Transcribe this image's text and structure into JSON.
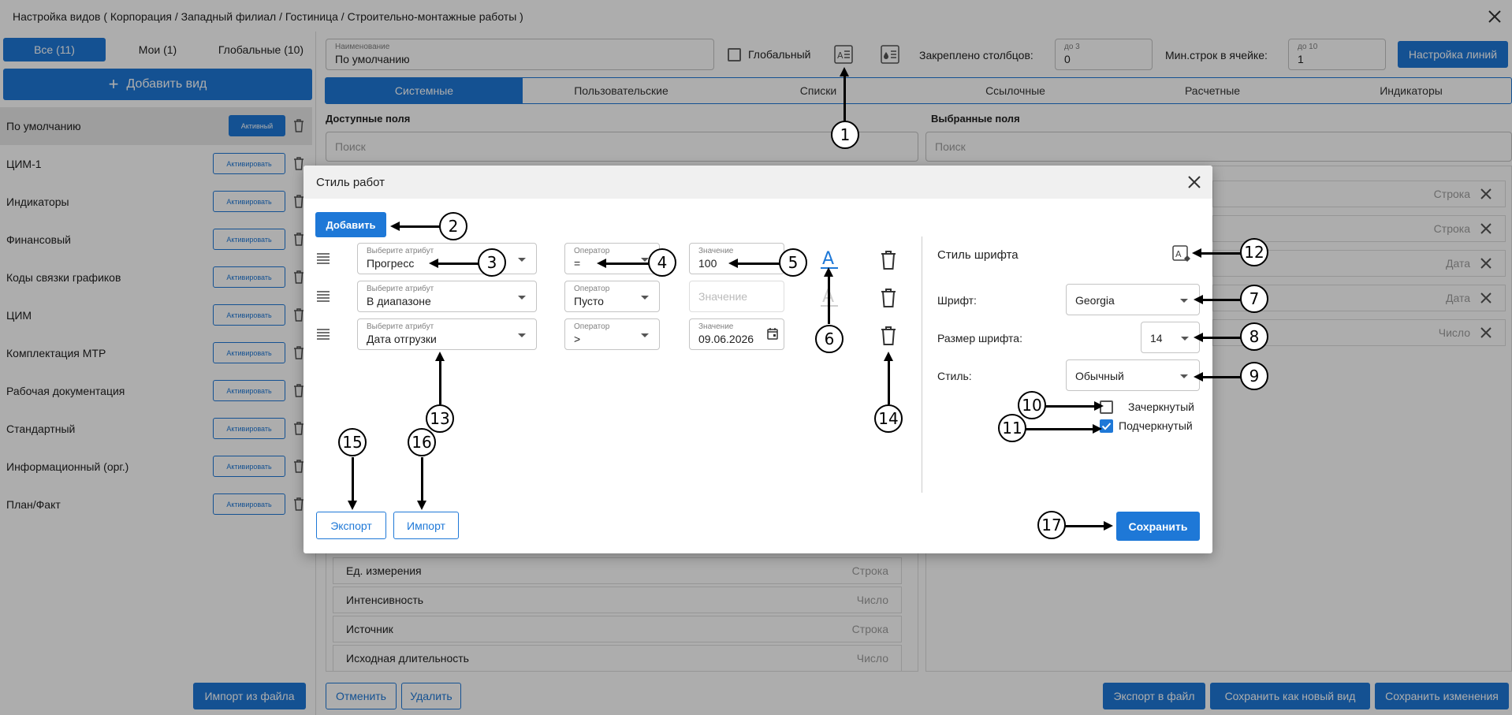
{
  "window": {
    "title": "Настройка видов ( Корпорация / Западный филиал / Гостиница / Строительно-монтажные работы )"
  },
  "left": {
    "filters": [
      "Все (11)",
      "Мои (1)",
      "Глобальные (10)"
    ],
    "add_view": "Добавить вид",
    "views": [
      {
        "name": "По умолчанию",
        "btn": "Активный"
      },
      {
        "name": "ЦИМ-1",
        "btn": "Активировать"
      },
      {
        "name": "Индикаторы",
        "btn": "Активировать"
      },
      {
        "name": "Финансовый",
        "btn": "Активировать"
      },
      {
        "name": "Коды связки графиков",
        "btn": "Активировать"
      },
      {
        "name": "ЦИМ",
        "btn": "Активировать"
      },
      {
        "name": "Комплектация МТР",
        "btn": "Активировать"
      },
      {
        "name": "Рабочая документация",
        "btn": "Активировать"
      },
      {
        "name": "Стандартный",
        "btn": "Активировать"
      },
      {
        "name": "Информационный (орг.)",
        "btn": "Активировать"
      },
      {
        "name": "План/Факт",
        "btn": "Активировать"
      }
    ],
    "import_file": "Импорт из файла"
  },
  "top": {
    "name_label": "Наименование",
    "name_value": "По умолчанию",
    "global_label": "Глобальный",
    "pinned_label": "Закреплено столбцов:",
    "pinned_hint": "до 3",
    "pinned_value": "0",
    "minrows_label": "Мин.строк в ячейке:",
    "minrows_hint": "до 10",
    "minrows_value": "1",
    "lines_btn": "Настройка линий"
  },
  "tabs": [
    "Системные",
    "Пользовательские",
    "Списки",
    "Ссылочные",
    "Расчетные",
    "Индикаторы"
  ],
  "fields": {
    "available_title": "Доступные поля",
    "selected_title": "Выбранные поля",
    "search_placeholder": "Поиск",
    "available_rows": [
      {
        "name": "Ед. измерения",
        "type": "Строка"
      },
      {
        "name": "Интенсивность",
        "type": "Число"
      },
      {
        "name": "Источник",
        "type": "Строка"
      },
      {
        "name": "Исходная длительность",
        "type": "Число"
      }
    ],
    "selected_types": [
      "Строка",
      "Строка",
      "Дата",
      "Дата",
      "Число"
    ]
  },
  "bottom": {
    "cancel": "Отменить",
    "delete": "Удалить",
    "export_file": "Экспорт в файл",
    "save_new": "Сохранить как новый вид",
    "save_changes": "Сохранить изменения"
  },
  "modal": {
    "title": "Стиль работ",
    "add": "Добавить",
    "attr_label": "Выберите атрибут",
    "op_label": "Оператор",
    "val_label": "Значение",
    "rules": [
      {
        "attr": "Прогресс",
        "op": "=",
        "value": "100"
      },
      {
        "attr": "В диапазоне",
        "op": "Пусто",
        "value": "Значение"
      },
      {
        "attr": "Дата отгрузки",
        "op": ">",
        "value": "09.06.2026"
      }
    ],
    "font_style_title": "Стиль шрифта",
    "font_label": "Шрифт:",
    "font_value": "Georgia",
    "size_label": "Размер шрифта:",
    "size_value": "14",
    "style_label": "Стиль:",
    "style_value": "Обычный",
    "strike_label": "Зачеркнутый",
    "underline_label": "Подчеркнутый",
    "export": "Экспорт",
    "import": "Импорт",
    "save": "Сохранить"
  },
  "callouts": [
    "1",
    "2",
    "3",
    "4",
    "5",
    "6",
    "7",
    "8",
    "9",
    "10",
    "11",
    "12",
    "13",
    "14",
    "15",
    "16",
    "17"
  ]
}
